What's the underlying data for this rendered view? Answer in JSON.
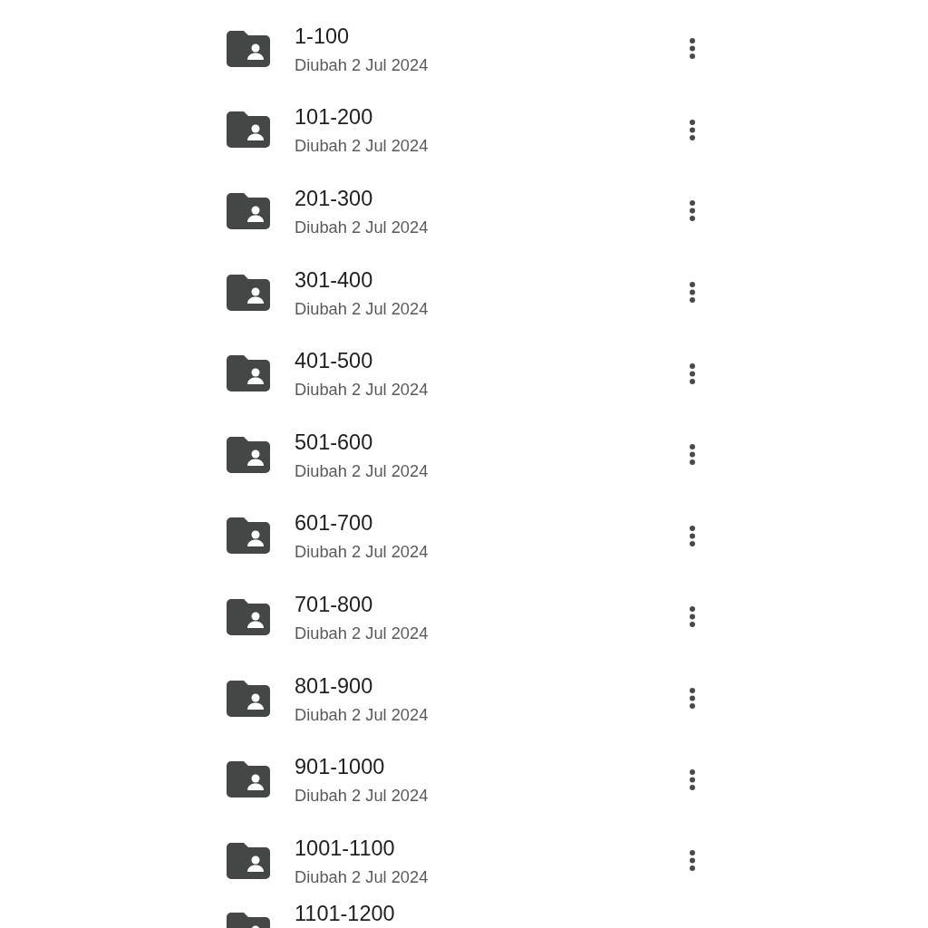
{
  "folders": [
    {
      "name": "1-100",
      "modified": "Diubah 2 Jul 2024"
    },
    {
      "name": "101-200",
      "modified": "Diubah 2 Jul 2024"
    },
    {
      "name": "201-300",
      "modified": "Diubah 2 Jul 2024"
    },
    {
      "name": "301-400",
      "modified": "Diubah 2 Jul 2024"
    },
    {
      "name": "401-500",
      "modified": "Diubah 2 Jul 2024"
    },
    {
      "name": "501-600",
      "modified": "Diubah 2 Jul 2024"
    },
    {
      "name": "601-700",
      "modified": "Diubah 2 Jul 2024"
    },
    {
      "name": "701-800",
      "modified": "Diubah 2 Jul 2024"
    },
    {
      "name": "801-900",
      "modified": "Diubah 2 Jul 2024"
    },
    {
      "name": "901-1000",
      "modified": "Diubah 2 Jul 2024"
    },
    {
      "name": "1001-1100",
      "modified": "Diubah 2 Jul 2024"
    },
    {
      "name": "1101-1200"
    }
  ]
}
